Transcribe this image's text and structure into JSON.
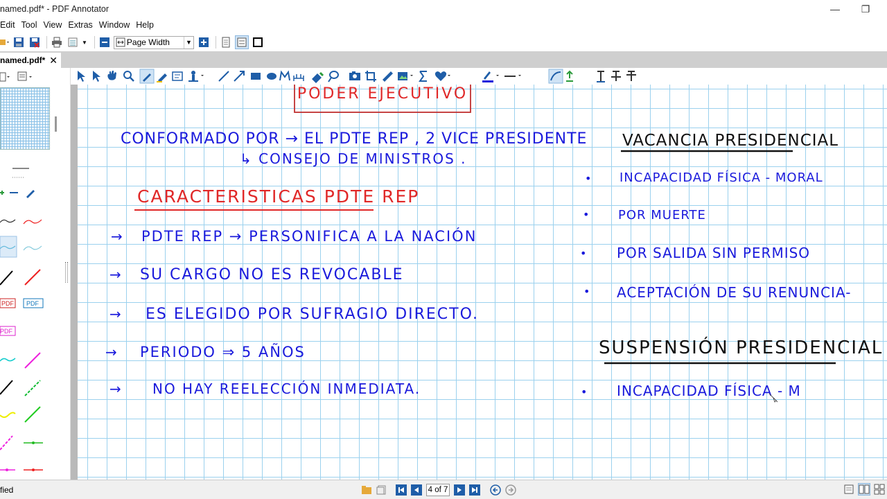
{
  "window": {
    "title": "named.pdf* - PDF Annotator",
    "minimize_glyph": "—",
    "restore_glyph": "❐"
  },
  "menu": [
    "Edit",
    "Tool",
    "View",
    "Extras",
    "Window",
    "Help"
  ],
  "toolbar": {
    "zoom_mode": "Page Width",
    "zoom_arrow": "▼"
  },
  "tab": {
    "name": "named.pdf*",
    "close_glyph": "✕"
  },
  "annotation_toolbar": {
    "icons": [
      "arrow-select-icon",
      "text-select-icon",
      "hand-icon",
      "magnifier-icon",
      "pen-icon",
      "highlighter-icon",
      "text-box-icon",
      "stamp-icon",
      "line-icon",
      "arrow-line-icon",
      "rectangle-icon",
      "ellipse-icon",
      "polyline-icon",
      "ruler-icon",
      "eraser-icon",
      "lasso-icon",
      "camera-icon",
      "crop-icon",
      "measure-icon",
      "picture-icon",
      "sum-icon",
      "favorite-icon",
      "color-icon",
      "line-width-icon",
      "smooth-icon",
      "straighten-icon",
      "text-color-icon",
      "strikeout-icon",
      "strike-text-icon"
    ]
  },
  "left_panel": {
    "pdf_stamp_label": "PDF"
  },
  "page_content": {
    "header_box": "PODER EJECUTIVO",
    "line1": "CONFORMADO POR → EL PDTE REP , 2 VICE PRESIDENTE",
    "line2": "↳ CONSEJO DE MINISTROS .",
    "section_title": "CARACTERISTICAS PDTE REP",
    "bullets": [
      "PDTE REP → PERSONIFICA A LA NACIÓN",
      "SU CARGO NO ES REVOCABLE",
      "ES ELEGIDO POR SUFRAGIO DIRECTO.",
      "PERIODO ⇒ 5 AÑOS",
      "NO HAY REELECCIÓN INMEDIATA."
    ],
    "bullet_marker": "→",
    "vacancia_title": "VACANCIA PRESIDENCIAL",
    "vacancia_items": [
      "INCAPACIDAD FÍSICA - MORAL",
      "POR MUERTE",
      "POR SALIDA SIN PERMISO",
      "ACEPTACIÓN DE SU RENUNCIA-"
    ],
    "suspension_title": "SUSPENSIÓN PRESIDENCIAL",
    "suspension_items": [
      "INCAPACIDAD FÍSICA - M"
    ],
    "dot_marker": "•"
  },
  "status": {
    "left_text": "fied",
    "page_indicator": "4 of 7"
  },
  "colors": {
    "ink_blue": "#1a1adc",
    "ink_red": "#e02828",
    "toolbar_blue": "#1f5ea8",
    "grid": "#9bd1ee"
  }
}
